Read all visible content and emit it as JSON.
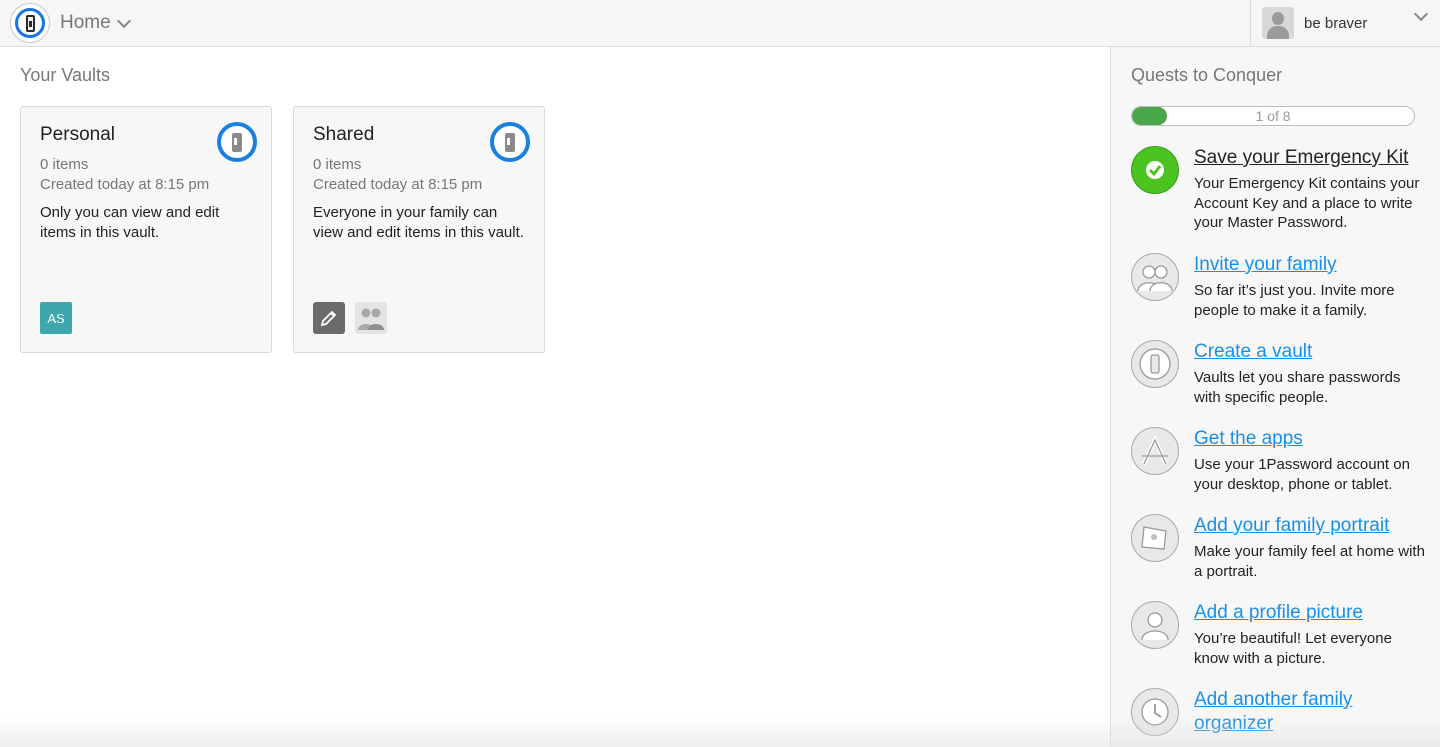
{
  "header": {
    "nav_title": "Home",
    "user_name": "be braver"
  },
  "main": {
    "section_title": "Your Vaults",
    "vaults": [
      {
        "name": "Personal",
        "items": "0 items",
        "created": "Created today at 8:15 pm",
        "description": "Only you can view and edit items in this vault.",
        "member_badge": "AS"
      },
      {
        "name": "Shared",
        "items": "0 items",
        "created": "Created today at 8:15 pm",
        "description": "Everyone in your family can view and edit items in this vault."
      }
    ]
  },
  "sidebar": {
    "title": "Quests to Conquer",
    "progress_text": "1 of 8",
    "progress_fraction": 0.125,
    "quests": [
      {
        "icon": "checkmark-icon",
        "title": "Save your Emergency Kit",
        "description": "Your Emergency Kit contains your Account Key and a place to write your Master Password.",
        "completed": true
      },
      {
        "icon": "family-icon",
        "title": "Invite your family",
        "description": "So far it’s just you. Invite more people to make it a family.",
        "completed": false
      },
      {
        "icon": "vault-icon",
        "title": "Create a vault",
        "description": "Vaults let you share passwords with specific people.",
        "completed": false
      },
      {
        "icon": "app-store-icon",
        "title": "Get the apps",
        "description": "Use your 1Password account on your desktop, phone or tablet.",
        "completed": false
      },
      {
        "icon": "flag-icon",
        "title": "Add your family portrait",
        "description": "Make your family feel at home with a portrait.",
        "completed": false
      },
      {
        "icon": "profile-icon",
        "title": "Add a profile picture",
        "description": "You’re beautiful! Let everyone know with a picture.",
        "completed": false
      },
      {
        "icon": "organizer-icon",
        "title": "Add another family organizer",
        "description": "",
        "completed": false
      }
    ]
  },
  "colors": {
    "accent": "#1a8fe6",
    "success": "#4bc421",
    "vault_ring": "#1a7fe0",
    "member_badge": "#3ea6ad"
  }
}
